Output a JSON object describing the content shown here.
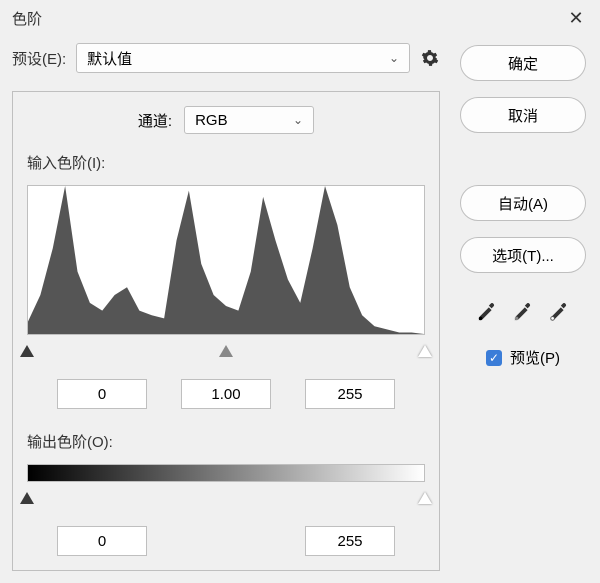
{
  "title": "色阶",
  "preset": {
    "label": "预设(E):",
    "value": "默认值"
  },
  "channel": {
    "label": "通道:",
    "value": "RGB"
  },
  "inputLevels": {
    "label": "输入色阶(I):",
    "black": "0",
    "gamma": "1.00",
    "white": "255"
  },
  "outputLevels": {
    "label": "输出色阶(O):",
    "black": "0",
    "white": "255"
  },
  "buttons": {
    "ok": "确定",
    "cancel": "取消",
    "auto": "自动(A)",
    "options": "选项(T)..."
  },
  "preview": {
    "label": "预览(P)",
    "checked": true
  },
  "chart_data": {
    "type": "bar",
    "title": "",
    "xlabel": "",
    "ylabel": "",
    "xlim": [
      0,
      255
    ],
    "ylim": [
      0,
      100
    ],
    "categories": [
      0,
      8,
      16,
      24,
      32,
      40,
      48,
      56,
      64,
      72,
      80,
      88,
      96,
      104,
      112,
      120,
      128,
      136,
      144,
      152,
      160,
      168,
      176,
      184,
      192,
      200,
      208,
      216,
      224,
      232,
      240,
      248,
      255
    ],
    "values": [
      8,
      25,
      55,
      95,
      40,
      20,
      15,
      25,
      30,
      15,
      12,
      10,
      60,
      92,
      45,
      25,
      18,
      15,
      40,
      88,
      60,
      35,
      20,
      55,
      95,
      70,
      30,
      12,
      5,
      3,
      1,
      1,
      0
    ]
  }
}
